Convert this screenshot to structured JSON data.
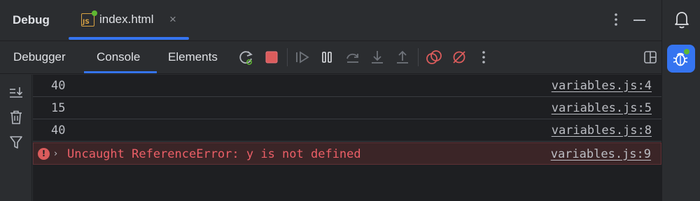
{
  "header": {
    "title": "Debug",
    "file_tab": {
      "icon_letters": "JS",
      "name": "index.html",
      "close_glyph": "×"
    }
  },
  "toolbar": {
    "tabs": [
      {
        "label": "Debugger"
      },
      {
        "label": "Console",
        "active": true
      },
      {
        "label": "Elements"
      }
    ],
    "icons": [
      "rerun-icon",
      "stop-icon",
      "resume-icon",
      "pause-icon",
      "step-over-icon",
      "step-into-icon",
      "step-out-icon",
      "view-breakpoints-icon",
      "mute-breakpoints-icon",
      "more-icon",
      "layout-icon"
    ]
  },
  "gutter": {
    "icons": [
      "scroll-to-end-icon",
      "clear-console-icon",
      "filter-icon"
    ]
  },
  "console": {
    "rows": [
      {
        "value": "40",
        "source": "variables.js:4"
      },
      {
        "value": "15",
        "source": "variables.js:5"
      },
      {
        "value": "40",
        "source": "variables.js:8"
      }
    ],
    "error": {
      "badge": "!",
      "arrow": "›",
      "message": "Uncaught ReferenceError: y is not defined",
      "source": "variables.js:9"
    }
  },
  "right_bar": {
    "icons": [
      "notifications-bell-icon",
      "debug-tool-window-icon"
    ]
  },
  "colors": {
    "accent": "#3574f0",
    "error_text": "#ec5f67",
    "error_background": "#3b2527",
    "stop_red": "#db5c5c",
    "js_badge": "#d9a343",
    "status_dot": "#5fb832"
  }
}
